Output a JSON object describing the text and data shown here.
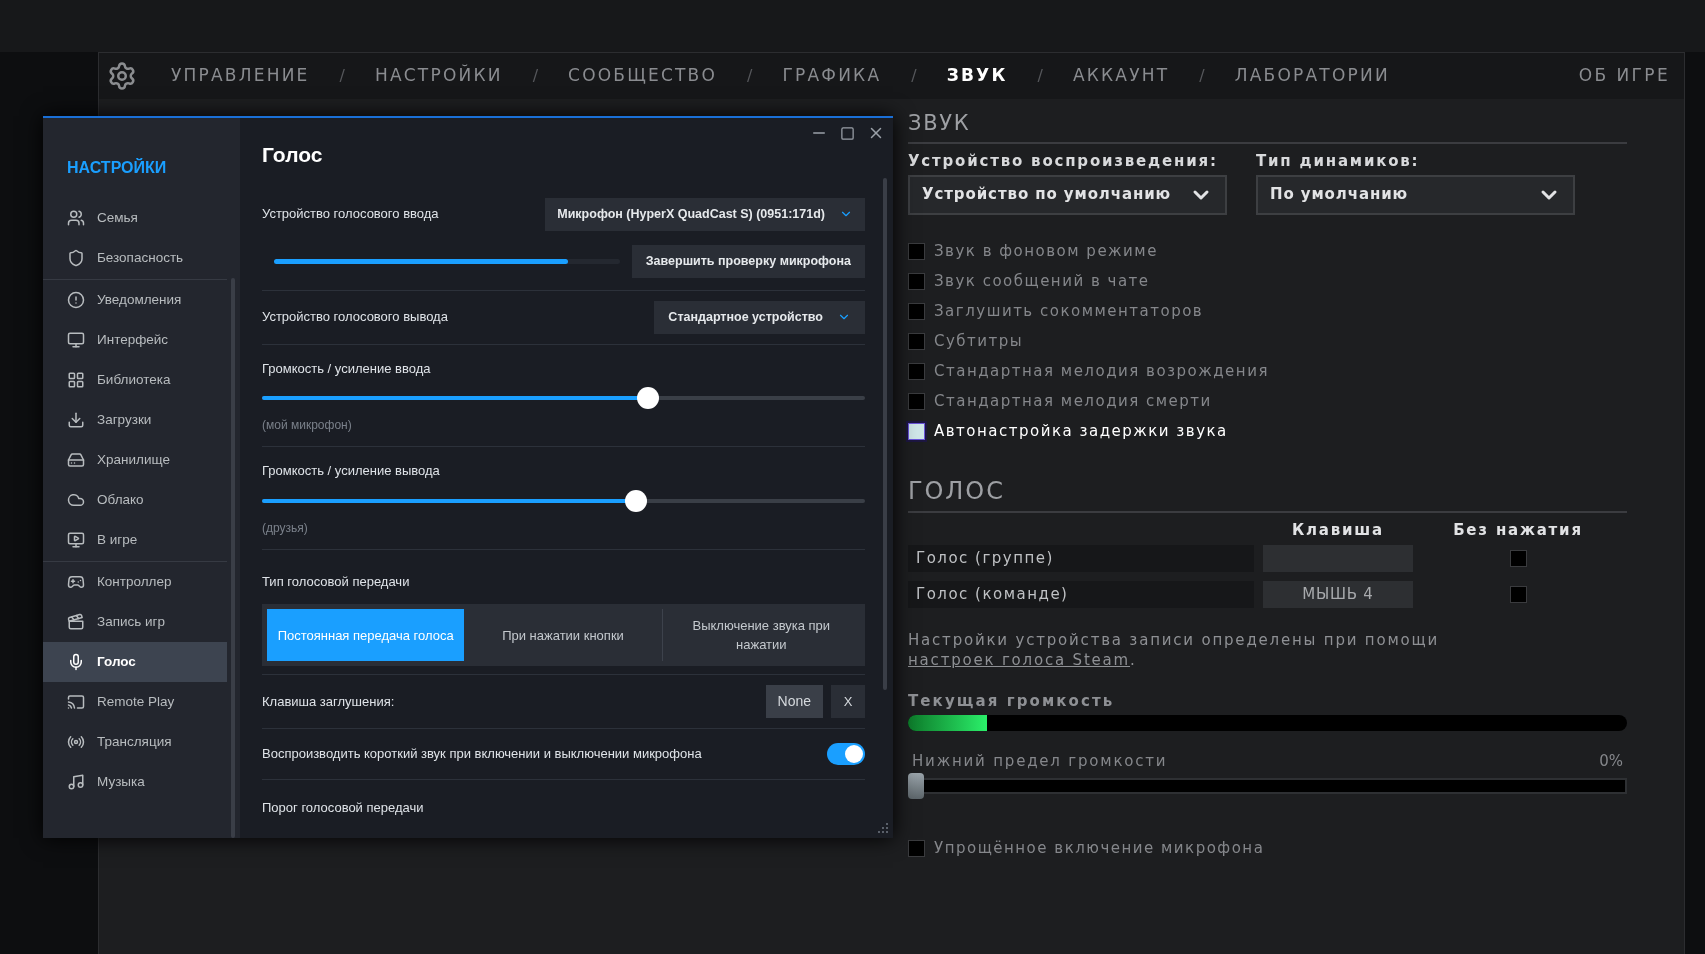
{
  "top_nav": {
    "items": [
      {
        "label": "УПРАВЛЕНИЕ",
        "selected": false
      },
      {
        "label": "НАСТРОЙКИ",
        "selected": false
      },
      {
        "label": "СООБЩЕСТВО",
        "selected": false
      },
      {
        "label": "ГРАФИКА",
        "selected": false
      },
      {
        "label": "ЗВУК",
        "selected": true
      },
      {
        "label": "АККАУНТ",
        "selected": false
      },
      {
        "label": "ЛАБОРАТОРИИ",
        "selected": false
      }
    ],
    "separators": [
      "/",
      "/",
      "/",
      "/",
      "/",
      "/"
    ],
    "about": "ОБ ИГРЕ"
  },
  "steam_window": {
    "sidebar": {
      "title": "НАСТРОЙКИ",
      "groups": [
        [
          {
            "label": "Семья",
            "selected": false
          },
          {
            "label": "Безопасность",
            "selected": false
          }
        ],
        [
          {
            "label": "Уведомления",
            "selected": false
          },
          {
            "label": "Интерфейс",
            "selected": false
          },
          {
            "label": "Библиотека",
            "selected": false
          },
          {
            "label": "Загрузки",
            "selected": false
          },
          {
            "label": "Хранилище",
            "selected": false
          },
          {
            "label": "Облако",
            "selected": false
          },
          {
            "label": "В игре",
            "selected": false
          }
        ],
        [
          {
            "label": "Контроллер",
            "selected": false
          },
          {
            "label": "Запись игр",
            "selected": false
          },
          {
            "label": "Голос",
            "selected": true
          },
          {
            "label": "Remote Play",
            "selected": false
          },
          {
            "label": "Трансляция",
            "selected": false
          },
          {
            "label": "Музыка",
            "selected": false
          }
        ]
      ]
    },
    "title": "Голос",
    "input_device": {
      "label": "Устройство голосового ввода",
      "value": "Микрофон (HyperX QuadCast S) (0951:171d)"
    },
    "mic_test": {
      "level": 0.85,
      "button": "Завершить проверку микрофона"
    },
    "output_device": {
      "label": "Устройство голосового вывода",
      "value": "Стандартное устройство"
    },
    "sliders": [
      {
        "label": "Громкость / усиление ввода",
        "level": 0.64,
        "caption": "(мой микрофон)"
      },
      {
        "label": "Громкость / усиление вывода",
        "level": 0.62,
        "caption": "(друзья)"
      }
    ],
    "transmission": {
      "label": "Тип голосовой передачи",
      "options": [
        {
          "label": "Постоянная передача голоса",
          "selected": true
        },
        {
          "label": "При нажатии кнопки",
          "selected": false
        },
        {
          "label": "Выключение звука при нажатии",
          "selected": false
        }
      ]
    },
    "mute_key": {
      "label": "Клавиша заглушения:",
      "value": "None",
      "clear": "X"
    },
    "beep_toggle": {
      "label": "Воспроизводить короткий звук при включении и выключении микрофона",
      "on": true
    },
    "threshold": {
      "label": "Порог голосовой передачи"
    }
  },
  "sound": {
    "title": "ЗВУК",
    "playback": {
      "label": "Устройство воспроизведения:",
      "value": "Устройство по умолчанию"
    },
    "speakers": {
      "label": "Тип динамиков:",
      "value": "По умолчанию"
    },
    "options": [
      {
        "label": "Звук в фоновом режиме",
        "checked": false
      },
      {
        "label": "Звук сообщений в чате",
        "checked": false
      },
      {
        "label": "Заглушить сокомментаторов",
        "checked": false
      },
      {
        "label": "Субтитры",
        "checked": false
      },
      {
        "label": "Стандартная мелодия возрождения",
        "checked": false
      },
      {
        "label": "Стандартная мелодия смерти",
        "checked": false
      },
      {
        "label": "Автонастройка задержки звука",
        "checked": true
      }
    ]
  },
  "voice": {
    "title": "ГОЛОС",
    "columns": [
      "Клавиша",
      "Без нажатия"
    ],
    "rows": [
      {
        "name": "Голос (группе)",
        "checked": false
      },
      {
        "name": "Голос (команде)",
        "key": "МЫШЬ 4",
        "checked": false
      }
    ],
    "note": {
      "text": "Настройки устройства записи определены при помощи ",
      "link": "настроек голоса Steam",
      "after": "."
    },
    "current_volume": {
      "label": "Текущая громкость",
      "level": 0.11
    },
    "threshold": {
      "label": "Нижний предел громкости",
      "reading": "0%",
      "level": 0
    },
    "simple_mic": {
      "label": "Упрощённое включение микрофона",
      "checked": false
    }
  }
}
